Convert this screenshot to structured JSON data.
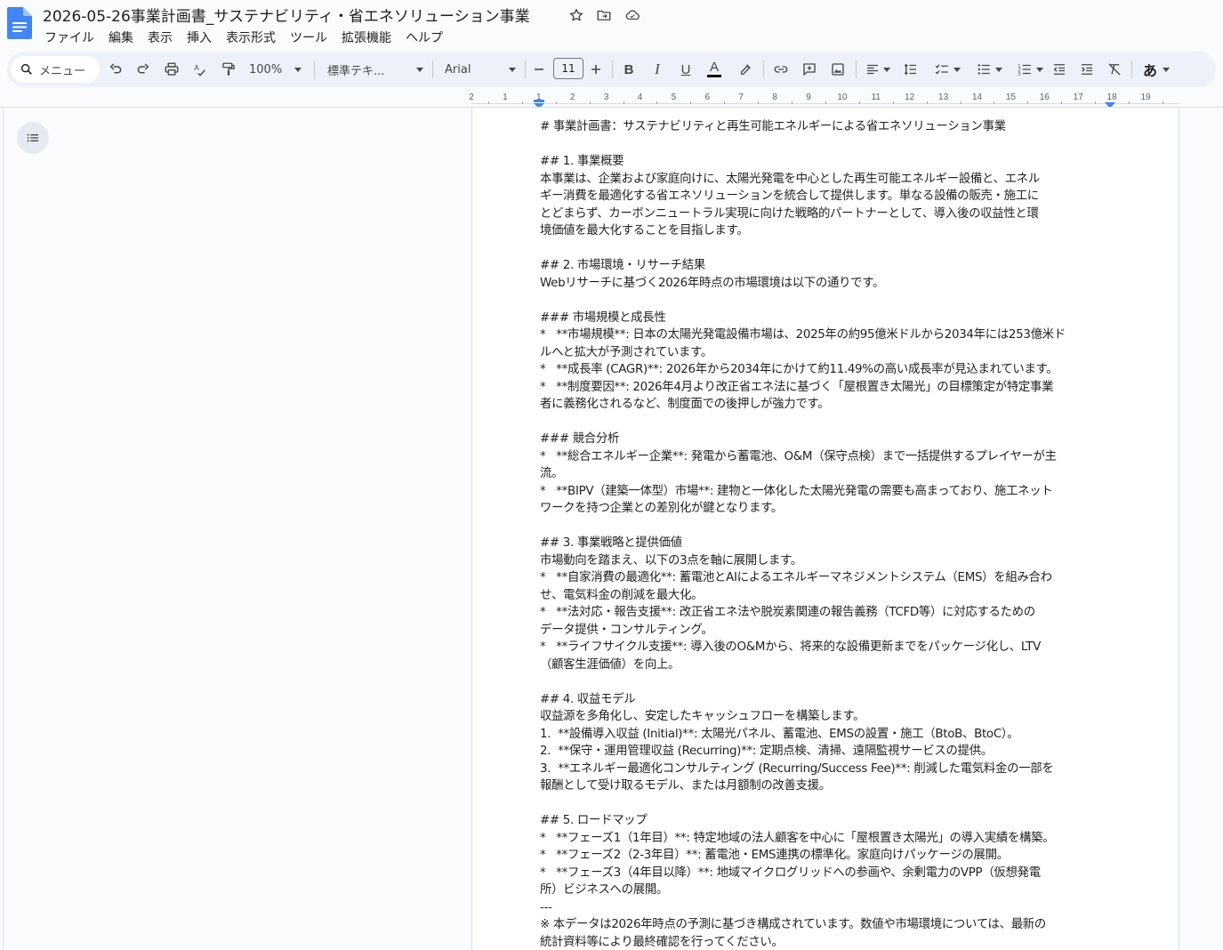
{
  "title_bar": {
    "doc_title": "2026-05-26事業計画書_サステナビリティ・省エネソリューション事業",
    "icons": [
      "docs-logo-icon",
      "star-icon",
      "move-to-folder-icon",
      "cloud-status-icon"
    ]
  },
  "menu": [
    "ファイル",
    "編集",
    "表示",
    "挿入",
    "表示形式",
    "ツール",
    "拡張機能",
    "ヘルプ"
  ],
  "toolbar": {
    "search_label": "メニュー",
    "zoom": "100%",
    "paragraph_style": "標準テキ...",
    "font": "Arial",
    "font_size": "11",
    "bold_label": "B",
    "italic_label": "I",
    "underline_label": "U",
    "text_color_label": "A",
    "input_tools_label": "あ"
  },
  "ruler": {
    "numbers": [
      "2",
      "1",
      "1",
      "2",
      "3",
      "4",
      "5",
      "6",
      "7",
      "8",
      "9",
      "10",
      "11",
      "12",
      "13",
      "14",
      "15",
      "16",
      "17",
      "18",
      "19"
    ]
  },
  "document": {
    "lines": [
      "# 事業計画書：サステナビリティと再生可能エネルギーによる省エネソリューション事業",
      "",
      "## 1. 事業概要",
      "本事業は、企業および家庭向けに、太陽光発電を中心とした再生可能エネルギー設備と、エネル",
      "ギー消費を最適化する省エネソリューションを統合して提供します。単なる設備の販売・施工に",
      "とどまらず、カーボンニュートラル実現に向けた戦略的パートナーとして、導入後の収益性と環",
      "境価値を最大化することを目指します。",
      "",
      "## 2. 市場環境・リサーチ結果",
      "Webリサーチに基づく2026年時点の市場環境は以下の通りです。",
      "",
      "### 市場規模と成長性",
      "*   **市場規模**: 日本の太陽光発電設備市場は、2025年の約95億米ドルから2034年には253億米ド",
      "ルへと拡大が予測されています。",
      "*   **成長率 (CAGR)**: 2026年から2034年にかけて約11.49%の高い成長率が見込まれています。",
      "*   **制度要因**: 2026年4月より改正省エネ法に基づく「屋根置き太陽光」の目標策定が特定事業",
      "者に義務化されるなど、制度面での後押しが強力です。",
      "",
      "### 競合分析",
      "*   **総合エネルギー企業**: 発電から蓄電池、O&M（保守点検）まで一括提供するプレイヤーが主",
      "流。",
      "*   **BIPV（建築一体型）市場**: 建物と一体化した太陽光発電の需要も高まっており、施工ネット",
      "ワークを持つ企業との差別化が鍵となります。",
      "",
      "## 3. 事業戦略と提供価値",
      "市場動向を踏まえ、以下の3点を軸に展開します。",
      "*   **自家消費の最適化**: 蓄電池とAIによるエネルギーマネジメントシステム（EMS）を組み合わ",
      "せ、電気料金の削減を最大化。",
      "*   **法対応・報告支援**: 改正省エネ法や脱炭素関連の報告義務（TCFD等）に対応するための",
      "データ提供・コンサルティング。",
      "*   **ライフサイクル支援**: 導入後のO&Mから、将来的な設備更新までをパッケージ化し、LTV",
      "（顧客生涯価値）を向上。",
      "",
      "## 4. 収益モデル",
      "収益源を多角化し、安定したキャッシュフローを構築します。",
      "1.  **設備導入収益 (Initial)**: 太陽光パネル、蓄電池、EMSの設置・施工（BtoB、BtoC）。",
      "2.  **保守・運用管理収益 (Recurring)**: 定期点検、清掃、遠隔監視サービスの提供。",
      "3.  **エネルギー最適化コンサルティング (Recurring/Success Fee)**: 削減した電気料金の一部を",
      "報酬として受け取るモデル、または月額制の改善支援。",
      "",
      "## 5. ロードマップ",
      "*   **フェーズ1（1年目）**: 特定地域の法人顧客を中心に「屋根置き太陽光」の導入実績を構築。",
      "*   **フェーズ2（2-3年目）**: 蓄電池・EMS連携の標準化。家庭向けパッケージの展開。",
      "*   **フェーズ3（4年目以降）**: 地域マイクログリッドへの参画や、余剰電力のVPP（仮想発電",
      "所）ビジネスへの展開。",
      "---",
      "※ 本データは2026年時点の予測に基づき構成されています。数値や市場環境については、最新の",
      "統計資料等により最終確認を行ってください。"
    ]
  }
}
